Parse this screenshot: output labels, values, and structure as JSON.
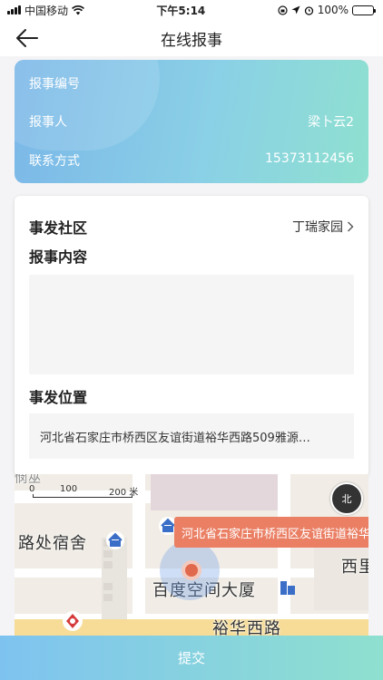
{
  "status_bar": {
    "carrier": "中国移动",
    "time": "下午5:14",
    "battery": "100%"
  },
  "nav": {
    "title": "在线报事",
    "back_icon": "arrow-left-icon"
  },
  "info_card": {
    "report_no_label": "报事编号",
    "report_no_value": "",
    "reporter_label": "报事人",
    "reporter_value": "梁卜云2",
    "contact_label": "联系方式",
    "contact_value": "15373112456"
  },
  "form": {
    "community_label": "事发社区",
    "community_value": "丁瑞家园",
    "content_label": "报事内容",
    "content_value": "",
    "location_label": "事发位置",
    "location_value": "河北省石家庄市桥西区友谊街道裕华西路509雅源…"
  },
  "map": {
    "scale_labels": [
      "0",
      "100",
      "200 米"
    ],
    "compass_label": "北",
    "callout_text": "河北省石家庄市桥西区友谊街道裕华西路",
    "labels": {
      "dormitory": "路处宿舍",
      "building": "百度空间大厦",
      "road": "裕华西路",
      "west": "西里",
      "top_left": "悯巫"
    }
  },
  "submit_label": "提交",
  "colors": {
    "card_gradient_start": "#7bb7e8",
    "card_gradient_end": "#8fe0d0",
    "callout": "#ea7f64",
    "pin": "#e0694d"
  }
}
